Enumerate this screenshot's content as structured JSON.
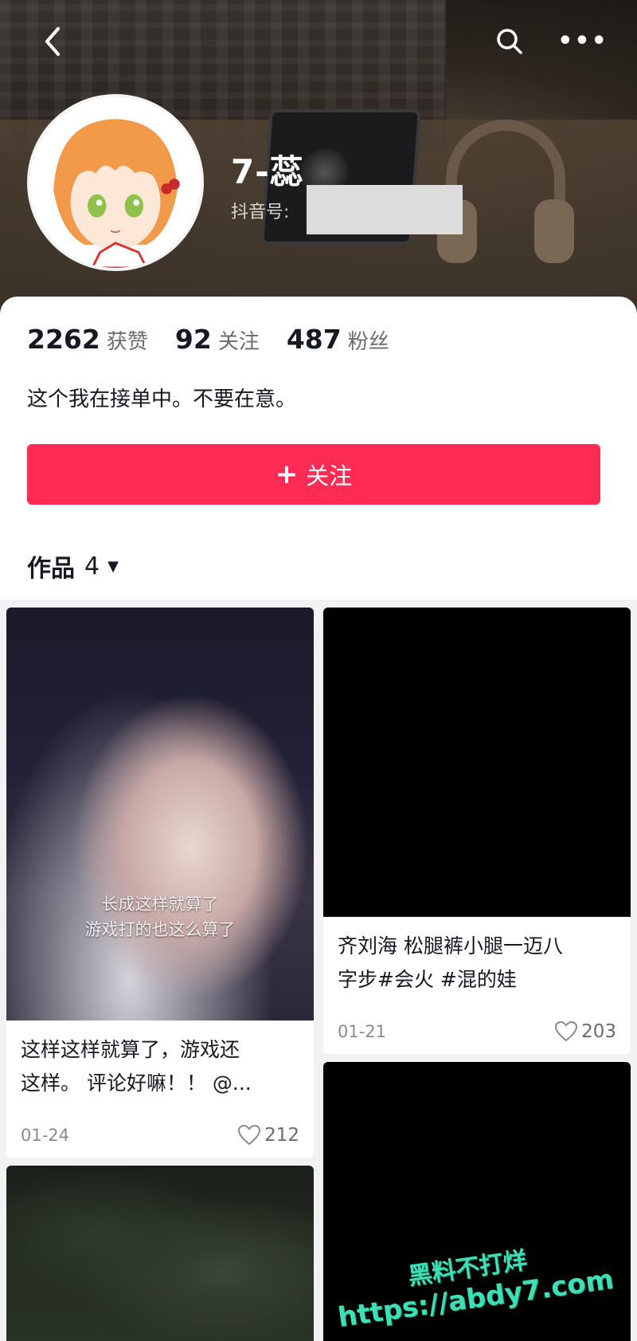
{
  "header": {
    "nickname": "7-蕊",
    "douyin_id_label": "抖音号:",
    "back_icon": "chevron-left-icon",
    "search_icon": "search-icon",
    "more_icon": "more-icon"
  },
  "profile": {
    "stats": [
      {
        "value": "2262",
        "label": "获赞"
      },
      {
        "value": "92",
        "label": "关注"
      },
      {
        "value": "487",
        "label": "粉丝"
      }
    ],
    "bio": "这个我在接单中。不要在意。",
    "follow_button": "关注",
    "works_tab": {
      "label": "作品",
      "count": "4"
    }
  },
  "posts": [
    {
      "overlay_line1": "长成这样就算了",
      "overlay_line2": "游戏打的也这么算了",
      "caption_line1": "这样这样就算了，游戏还",
      "caption_line2": "这样。 评论好嘛！！ @...",
      "date": "01-24",
      "likes": "212"
    },
    {
      "caption_line1": "齐刘海 松腿裤小腿一迈八",
      "caption_line2": "字步#会火 #混的娃",
      "date": "01-21",
      "likes": "203"
    }
  ],
  "watermark": {
    "line1": "黑料不打烊",
    "line2": "https://abdy7.com"
  },
  "colors": {
    "follow_button": "#fe2c55",
    "watermark": "#3de0b6"
  }
}
